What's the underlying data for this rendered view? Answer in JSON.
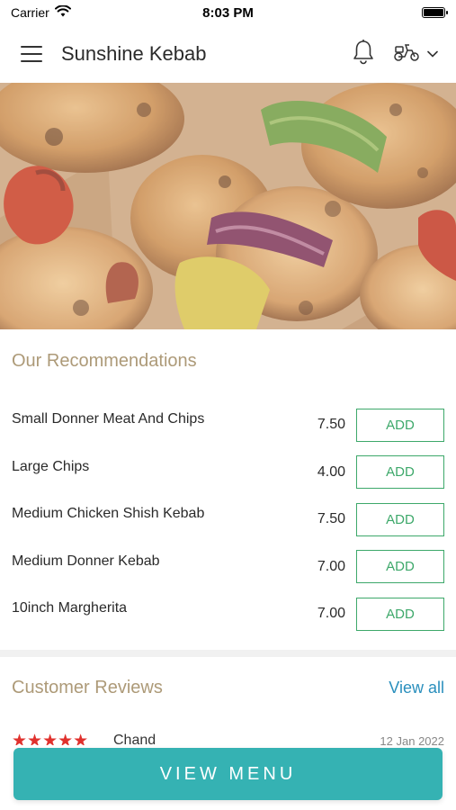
{
  "status": {
    "carrier": "Carrier",
    "time": "8:03 PM"
  },
  "header": {
    "title": "Sunshine Kebab"
  },
  "hero": {
    "image": "kebab-skewers-photo"
  },
  "recommendations": {
    "title": "Our Recommendations",
    "add_label": "ADD",
    "items": [
      {
        "name": "Small Donner Meat And Chips",
        "price": "7.50"
      },
      {
        "name": "Large Chips",
        "price": "4.00"
      },
      {
        "name": "Medium Chicken Shish Kebab",
        "price": "7.50"
      },
      {
        "name": "Medium Donner Kebab",
        "price": "7.00"
      },
      {
        "name": "10inch Margherita",
        "price": "7.00"
      }
    ]
  },
  "reviews": {
    "title": "Customer Reviews",
    "view_all": "View all",
    "first": {
      "stars": 5,
      "name": "Chand",
      "date": "12 Jan 2022"
    }
  },
  "cta": {
    "label": "VIEW MENU"
  },
  "colors": {
    "accent": "#35b2b3",
    "add_green": "#3da86a",
    "section_title": "#ad9a78",
    "link": "#2a8fbd",
    "star": "#e0312d"
  }
}
